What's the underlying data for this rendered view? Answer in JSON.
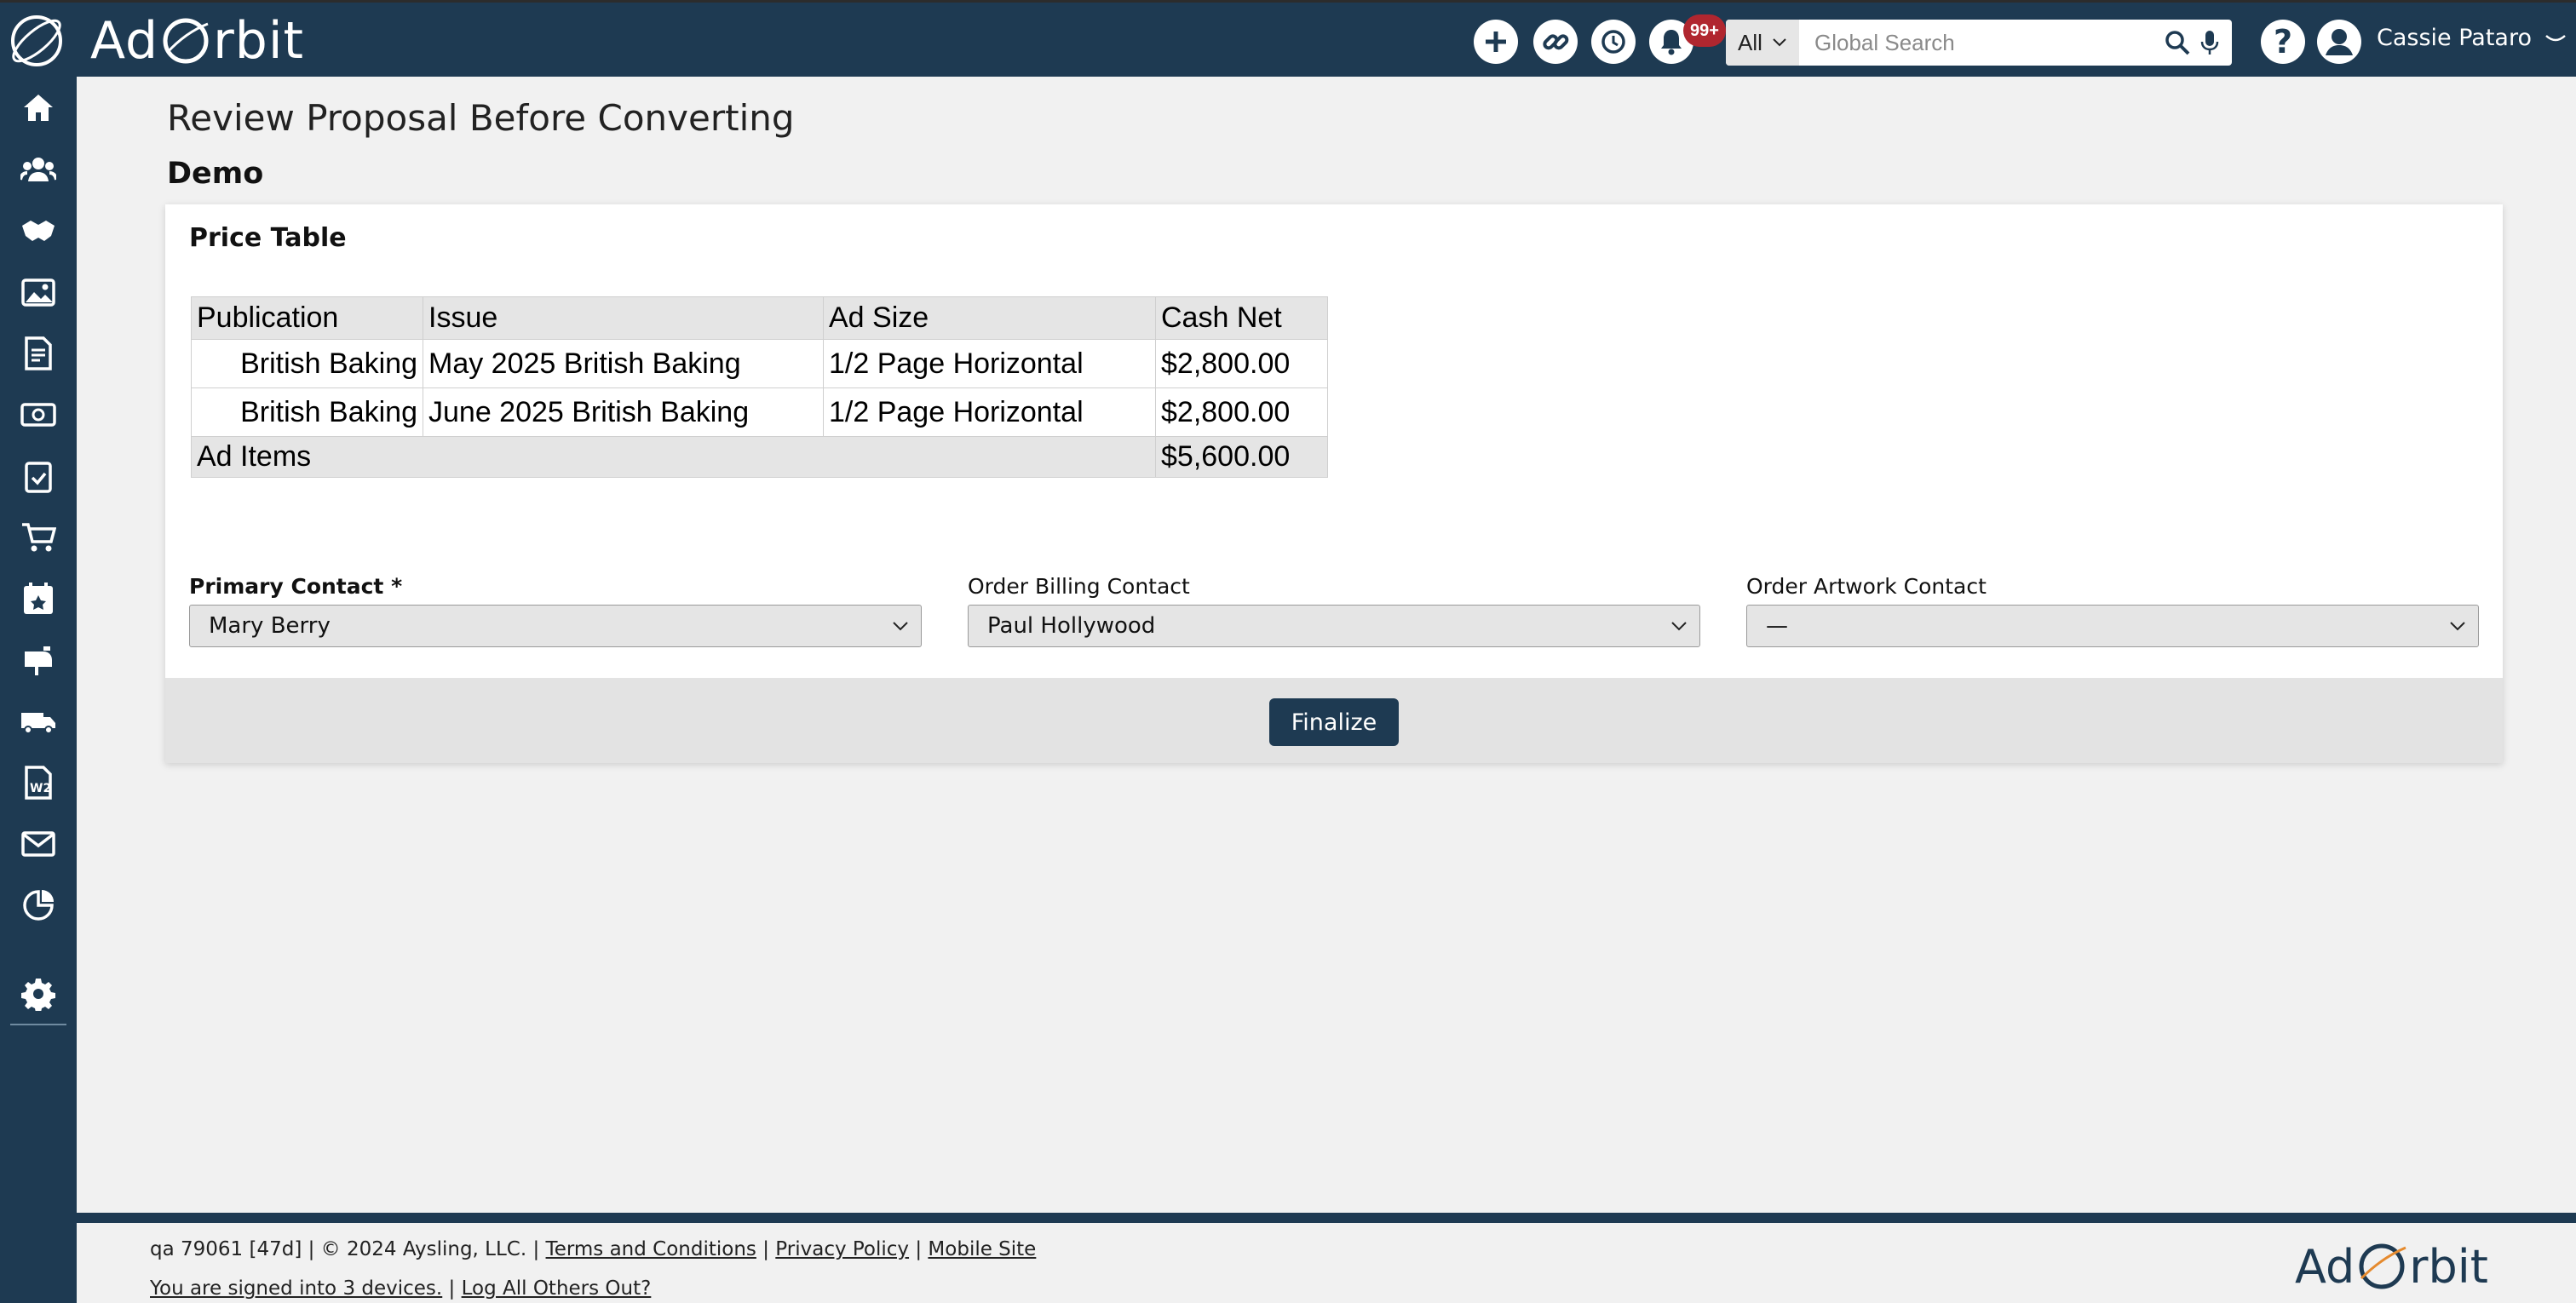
{
  "app": {
    "brand_left": "Ad",
    "brand_right": "rbit"
  },
  "topbar": {
    "icons": [
      "plus-circle-icon",
      "link-icon",
      "history-icon",
      "bell-icon"
    ],
    "notification_badge": "99+",
    "search": {
      "scope": "All",
      "placeholder": "Global Search"
    },
    "user_name": "Cassie Pataro"
  },
  "sidebar": {
    "items": [
      "home-icon",
      "contacts-icon",
      "handshake-icon",
      "media-icon",
      "invoice-icon",
      "payments-icon",
      "tasks-icon",
      "cart-icon",
      "calendar-icon",
      "mailbox-icon",
      "delivery-icon",
      "w2-icon",
      "mail-icon",
      "reports-icon",
      "settings-icon"
    ]
  },
  "page": {
    "title": "Review Proposal Before Converting",
    "subtitle": "Demo"
  },
  "price_table": {
    "title": "Price Table",
    "headers": [
      "Publication",
      "Issue",
      "Ad Size",
      "Cash Net"
    ],
    "rows": [
      [
        "British Baking",
        "May 2025 British Baking",
        "1/2 Page Horizontal",
        "$2,800.00"
      ],
      [
        "British Baking",
        "June 2025 British Baking",
        "1/2 Page Horizontal",
        "$2,800.00"
      ]
    ],
    "total_label": "Ad Items",
    "total_value": "$5,600.00"
  },
  "contacts": {
    "primary_label": "Primary Contact *",
    "primary_value": "Mary Berry",
    "billing_label": "Order Billing Contact",
    "billing_value": "Paul Hollywood",
    "artwork_label": "Order Artwork Contact",
    "artwork_value": "—"
  },
  "actions": {
    "finalize_label": "Finalize"
  },
  "footer": {
    "version": "qa 79061 [47d] | © 2024 Aysling, LLC. |",
    "terms": "Terms and Conditions",
    "privacy": "Privacy Policy",
    "mobile": "Mobile Site",
    "signed_in": "You are signed into 3 devices.",
    "logout_others": "Log All Others Out?",
    "sep": "|"
  },
  "colors": {
    "navy": "#1e3a52",
    "badge_red": "#b0262f",
    "orbit_orange": "#e58a2e"
  }
}
